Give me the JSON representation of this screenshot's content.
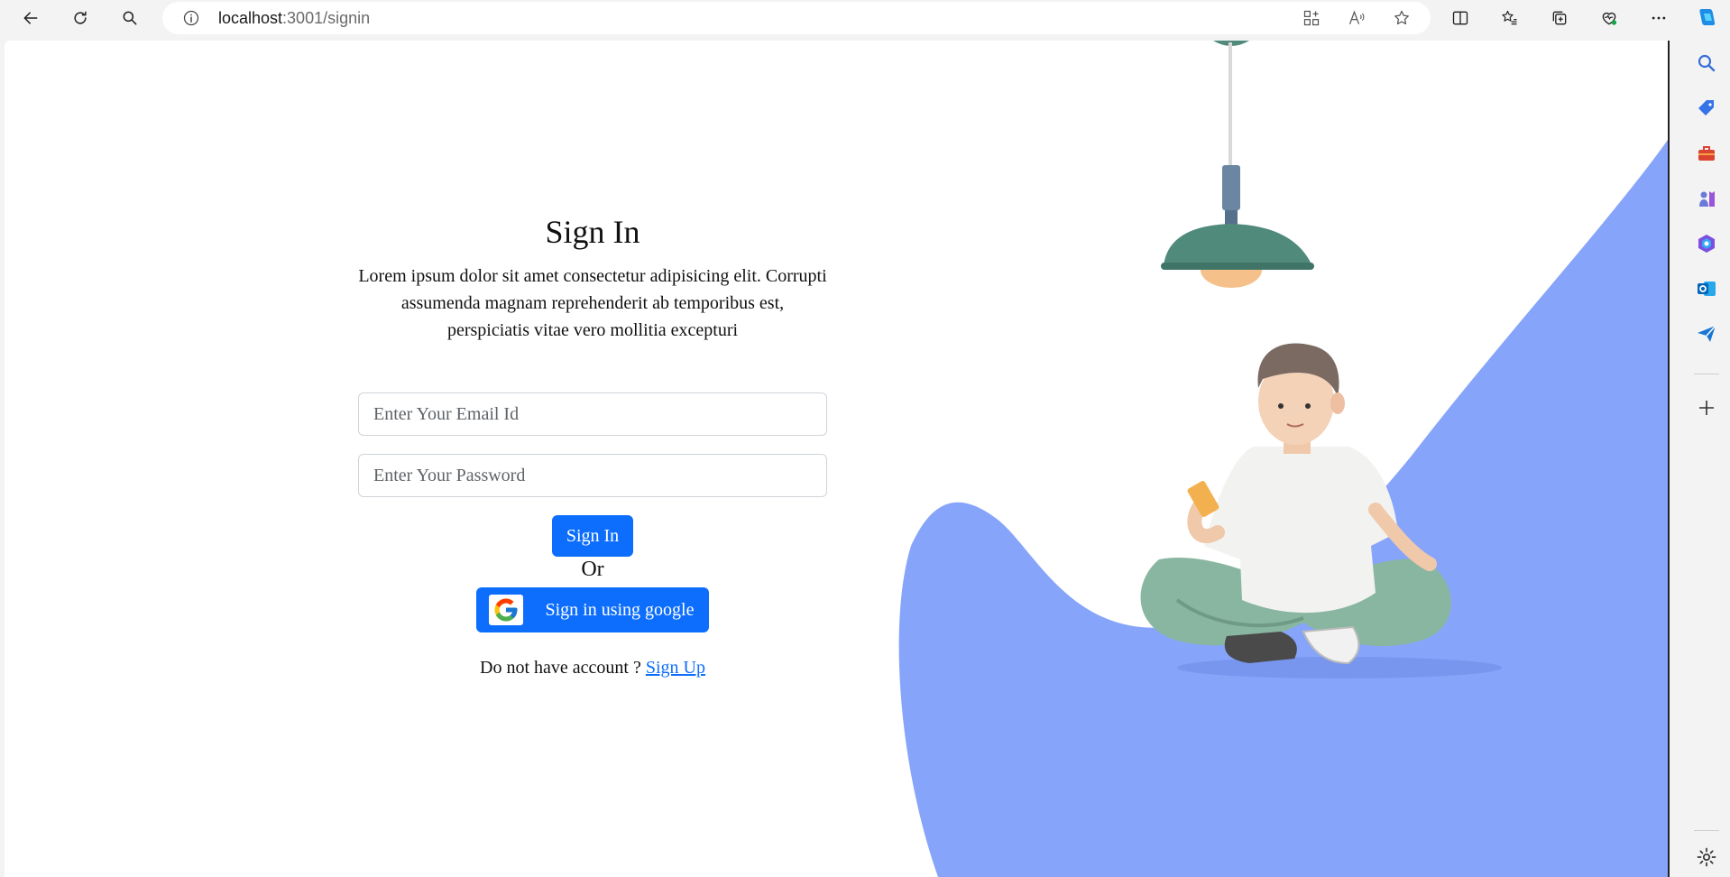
{
  "browser": {
    "url_host": "localhost",
    "url_path": ":3001/signin"
  },
  "page": {
    "title": "Sign In",
    "description": "Lorem ipsum dolor sit amet consectetur adipisicing elit. Corrupti assumenda magnam reprehenderit ab temporibus est, perspiciatis vitae vero mollitia excepturi",
    "email_placeholder": "Enter Your Email Id",
    "password_placeholder": "Enter Your Password",
    "signin_button": "Sign In",
    "or_text": "Or",
    "google_button": "Sign in using google",
    "no_account_text": "Do not have account ? ",
    "signup_link": "Sign Up"
  },
  "colors": {
    "primary": "#0d6efd",
    "blob": "#87a4fb",
    "lamp": "#4f8a7b"
  }
}
